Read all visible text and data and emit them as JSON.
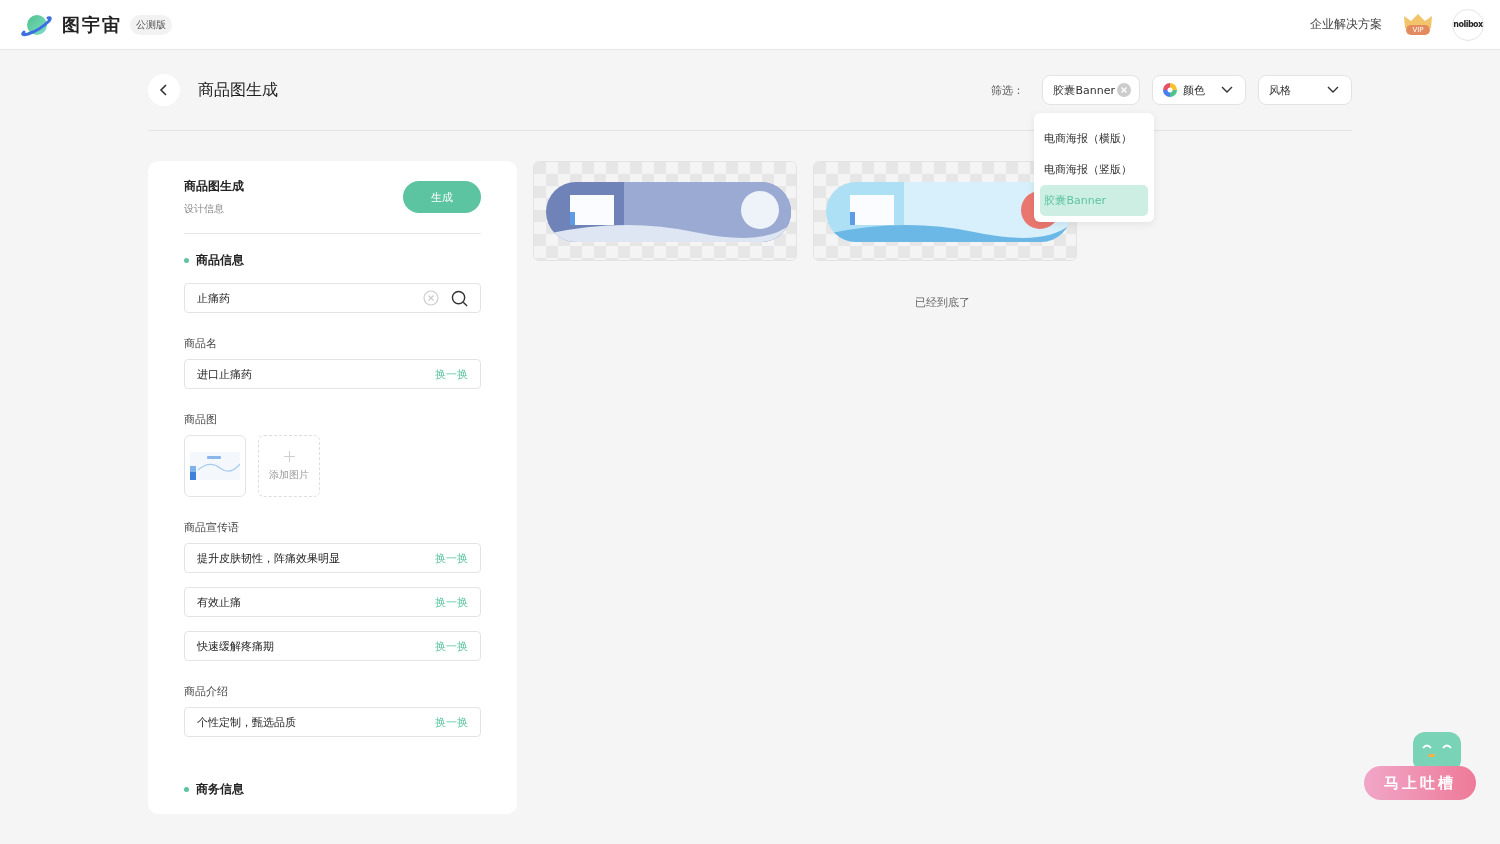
{
  "header": {
    "logo_text": "图宇宙",
    "badge": "公测版",
    "enterprise_link": "企业解决方案",
    "vip_label": "VIP",
    "avatar_text": "nolibox"
  },
  "page": {
    "title": "商品图生成"
  },
  "filters": {
    "label": "筛选：",
    "type_chip": "胶囊Banner",
    "color_label": "颜色",
    "style_label": "风格"
  },
  "type_menu": {
    "options": [
      {
        "label": "电商海报（横版）",
        "selected": false
      },
      {
        "label": "电商海报（竖版）",
        "selected": false
      },
      {
        "label": "胶囊Banner",
        "selected": true
      }
    ]
  },
  "form": {
    "title": "商品图生成",
    "subtitle": "设计信息",
    "generate_button": "生成",
    "product_section": "商品信息",
    "search_value": "止痛药",
    "name_label": "商品名",
    "name_field": {
      "value": "进口止痛药",
      "action": "换一换"
    },
    "image_label": "商品图",
    "add_image": "添加图片",
    "slogan_label": "商品宣传语",
    "slogans": [
      {
        "value": "提升皮肤韧性，阵痛效果明显",
        "action": "换一换"
      },
      {
        "value": "有效止痛",
        "action": "换一换"
      },
      {
        "value": "快速缓解疼痛期",
        "action": "换一换"
      }
    ],
    "intro_label": "商品介绍",
    "intros": [
      {
        "value": "个性定制，甄选品质",
        "action": "换一换"
      }
    ],
    "business_section": "商务信息"
  },
  "results": {
    "end_text": "已经到底了"
  },
  "feedback": {
    "label": "马上吐槽"
  }
}
